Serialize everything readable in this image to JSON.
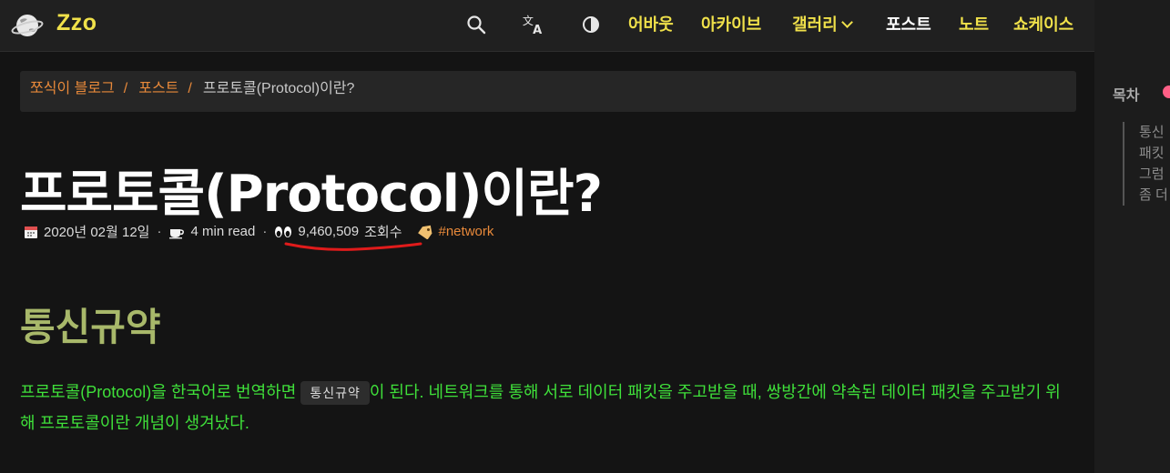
{
  "header": {
    "brand": "Zzo",
    "icons": [
      "search-icon",
      "translate-icon",
      "theme-toggle-icon"
    ],
    "nav": [
      {
        "label": "어바웃"
      },
      {
        "label": "아카이브"
      },
      {
        "label": "갤러리"
      },
      {
        "label": "포스트"
      },
      {
        "label": "노트"
      },
      {
        "label": "쇼케이스"
      }
    ],
    "active_nav": "포스트",
    "colors": {
      "accent": "#f0e14a",
      "active": "#ffffff",
      "background": "#202020"
    }
  },
  "breadcrumb": {
    "items": [
      "쪼식이 블로그",
      "포스트"
    ],
    "separator": "/",
    "current": "프로토콜(Protocol)이란?"
  },
  "post": {
    "title": "프로토콜(Protocol)이란?",
    "date": "2020년 02월 12일",
    "read_time": "4 min read",
    "views": "9,460,509",
    "views_suffix": "조회수",
    "tag": "#network",
    "separator": "·",
    "section_heading": "통신규약",
    "para_before": "프로토콜(Protocol)을 한국어로 번역하면 ",
    "code_term": "통신규약",
    "para_after": "이 된다. 네트워크를 통해 서로 데이터 패킷을 주고받을 때, 쌍방간에 약속된 데이터 패킷을 주고받기 위해 프로토콜이란 개념이 생겨났다."
  },
  "toc": {
    "title": "목차",
    "items": [
      "통신",
      "패킷",
      "그럼",
      "좀 더"
    ]
  }
}
